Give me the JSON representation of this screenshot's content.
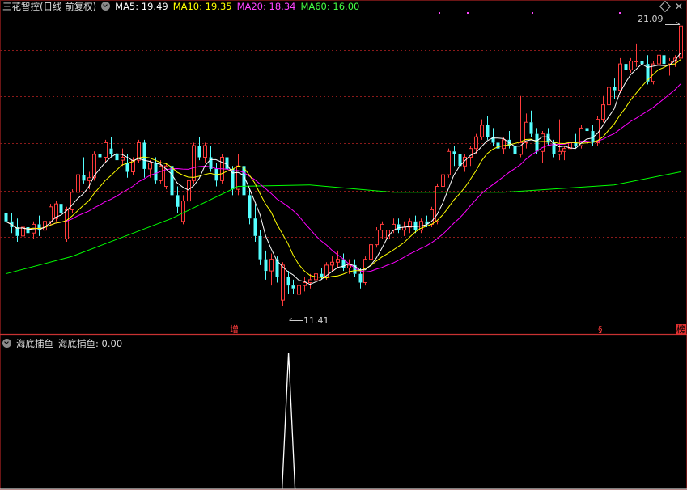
{
  "main_header": {
    "title": "三花智控(日线 前复权)",
    "ma5": "MA5: 19.49",
    "ma10": "MA10: 19.35",
    "ma20": "MA20: 18.34",
    "ma60": "MA60: 16.00"
  },
  "sub_header": {
    "indicator": "海底捕鱼",
    "value": "海底捕鱼: 0.00"
  },
  "annotations": {
    "high": "21.09",
    "low": "11.41",
    "tag_zeng": "增",
    "tag_s": "§",
    "tag_bang": "榜"
  },
  "icons": [
    "chevron-down-icon",
    "diamond-icon",
    "close-icon"
  ],
  "colors": {
    "background": "#000000",
    "up_candle": "#ff3b3b",
    "down_candle": "#54ffff",
    "ma5": "#ffffff",
    "ma10": "#ffff00",
    "ma20": "#ff00ff",
    "ma60": "#00ff00",
    "grid": "#8b1a1a",
    "separator": "#c83232"
  },
  "chart_data": {
    "type": "candlestick",
    "price_scale": {
      "high": 21.09,
      "low": 11.41
    },
    "ma_values_last": {
      "MA5": 19.49,
      "MA10": 19.35,
      "MA20": 18.34,
      "MA60": 16.0
    },
    "candles": [
      [
        14.6,
        14.9,
        14.1,
        14.3
      ],
      [
        14.3,
        14.6,
        13.9,
        14.1
      ],
      [
        14.1,
        14.4,
        13.6,
        13.8
      ],
      [
        13.8,
        14.2,
        13.6,
        14.1
      ],
      [
        14.1,
        14.4,
        13.8,
        13.9
      ],
      [
        13.9,
        14.3,
        13.7,
        14.2
      ],
      [
        14.2,
        14.5,
        13.8,
        14.0
      ],
      [
        14.0,
        14.4,
        13.9,
        14.3
      ],
      [
        14.3,
        14.9,
        14.2,
        14.8
      ],
      [
        14.4,
        15.0,
        14.3,
        14.9
      ],
      [
        14.9,
        15.2,
        14.5,
        14.6
      ],
      [
        13.7,
        14.8,
        13.6,
        14.7
      ],
      [
        14.7,
        15.4,
        14.6,
        15.3
      ],
      [
        15.3,
        16.0,
        15.2,
        15.9
      ],
      [
        15.9,
        16.5,
        15.6,
        15.7
      ],
      [
        15.7,
        16.0,
        15.4,
        15.8
      ],
      [
        15.8,
        16.7,
        15.7,
        16.6
      ],
      [
        16.6,
        17.0,
        16.3,
        16.5
      ],
      [
        16.5,
        17.1,
        16.3,
        17.0
      ],
      [
        16.8,
        17.2,
        16.5,
        16.6
      ],
      [
        16.6,
        16.9,
        16.2,
        16.4
      ],
      [
        16.4,
        16.8,
        16.2,
        16.5
      ],
      [
        16.3,
        16.6,
        15.8,
        16.0
      ],
      [
        16.0,
        16.5,
        15.9,
        16.4
      ],
      [
        16.4,
        17.1,
        16.3,
        17.0
      ],
      [
        17.0,
        17.1,
        15.8,
        16.1
      ],
      [
        16.1,
        16.4,
        15.8,
        16.3
      ],
      [
        16.3,
        16.5,
        15.6,
        15.7
      ],
      [
        15.7,
        16.4,
        15.6,
        16.2
      ],
      [
        15.5,
        16.3,
        15.4,
        16.2
      ],
      [
        16.2,
        16.5,
        15.0,
        15.2
      ],
      [
        15.2,
        15.5,
        14.6,
        14.8
      ],
      [
        14.3,
        15.2,
        14.2,
        15.0
      ],
      [
        15.0,
        15.8,
        14.9,
        15.7
      ],
      [
        15.7,
        17.0,
        15.6,
        16.9
      ],
      [
        16.9,
        17.2,
        16.4,
        16.5
      ],
      [
        16.5,
        17.0,
        16.3,
        16.9
      ],
      [
        16.5,
        16.9,
        16.0,
        16.1
      ],
      [
        16.1,
        16.3,
        15.5,
        15.7
      ],
      [
        15.7,
        16.6,
        15.6,
        16.5
      ],
      [
        16.5,
        16.7,
        16.0,
        16.1
      ],
      [
        16.1,
        16.2,
        15.2,
        15.4
      ],
      [
        15.4,
        16.6,
        15.2,
        16.2
      ],
      [
        16.2,
        16.5,
        15.0,
        15.2
      ],
      [
        15.2,
        15.4,
        14.2,
        14.4
      ],
      [
        14.4,
        14.9,
        13.6,
        13.8
      ],
      [
        13.8,
        14.0,
        12.8,
        13.0
      ],
      [
        13.0,
        13.3,
        12.3,
        12.6
      ],
      [
        12.6,
        13.2,
        12.1,
        13.0
      ],
      [
        13.0,
        13.1,
        12.2,
        12.4
      ],
      [
        11.6,
        12.9,
        11.4,
        12.8
      ],
      [
        12.4,
        12.6,
        11.8,
        12.1
      ],
      [
        12.1,
        12.3,
        11.8,
        12.0
      ],
      [
        11.8,
        12.2,
        11.6,
        12.1
      ],
      [
        12.1,
        12.4,
        11.9,
        12.2
      ],
      [
        12.2,
        12.5,
        12.0,
        12.3
      ],
      [
        12.3,
        12.6,
        12.1,
        12.5
      ],
      [
        12.5,
        12.7,
        12.3,
        12.4
      ],
      [
        12.4,
        12.9,
        12.3,
        12.8
      ],
      [
        12.8,
        13.1,
        12.6,
        12.9
      ],
      [
        12.9,
        13.3,
        12.7,
        13.0
      ],
      [
        13.0,
        13.2,
        12.6,
        12.7
      ],
      [
        12.7,
        13.0,
        12.5,
        12.8
      ],
      [
        12.8,
        13.0,
        12.4,
        12.5
      ],
      [
        12.5,
        12.7,
        12.0,
        12.2
      ],
      [
        12.2,
        13.1,
        12.1,
        13.0
      ],
      [
        13.0,
        13.6,
        12.9,
        13.5
      ],
      [
        13.5,
        14.1,
        13.4,
        14.0
      ],
      [
        14.0,
        14.3,
        13.7,
        14.2
      ],
      [
        13.7,
        14.3,
        13.6,
        14.0
      ],
      [
        14.0,
        14.4,
        13.9,
        14.2
      ],
      [
        14.2,
        14.4,
        13.9,
        14.0
      ],
      [
        14.0,
        14.3,
        13.8,
        14.1
      ],
      [
        14.1,
        14.4,
        13.9,
        14.3
      ],
      [
        14.3,
        14.5,
        13.9,
        14.0
      ],
      [
        14.0,
        14.4,
        13.9,
        14.3
      ],
      [
        14.3,
        14.5,
        14.1,
        14.2
      ],
      [
        14.2,
        14.8,
        14.1,
        14.7
      ],
      [
        14.3,
        15.6,
        14.2,
        15.5
      ],
      [
        15.5,
        16.0,
        15.3,
        15.9
      ],
      [
        15.9,
        16.8,
        15.8,
        16.7
      ],
      [
        16.7,
        16.9,
        16.2,
        16.6
      ],
      [
        16.6,
        16.8,
        16.1,
        16.2
      ],
      [
        16.2,
        16.6,
        16.0,
        16.5
      ],
      [
        16.5,
        16.9,
        16.2,
        16.8
      ],
      [
        16.8,
        17.3,
        16.6,
        17.2
      ],
      [
        17.2,
        17.8,
        17.1,
        17.6
      ],
      [
        17.6,
        17.9,
        17.1,
        17.2
      ],
      [
        17.2,
        17.5,
        16.9,
        17.0
      ],
      [
        17.0,
        17.3,
        16.7,
        16.8
      ],
      [
        16.8,
        17.2,
        16.6,
        17.1
      ],
      [
        17.1,
        17.4,
        16.8,
        16.9
      ],
      [
        16.9,
        17.1,
        16.5,
        16.6
      ],
      [
        16.6,
        18.6,
        16.5,
        17.0
      ],
      [
        17.0,
        18.0,
        16.8,
        17.7
      ],
      [
        17.7,
        18.1,
        17.2,
        17.3
      ],
      [
        17.3,
        17.5,
        16.6,
        16.7
      ],
      [
        16.7,
        17.4,
        16.3,
        17.3
      ],
      [
        17.3,
        17.5,
        16.9,
        17.0
      ],
      [
        17.0,
        17.1,
        16.5,
        16.6
      ],
      [
        16.6,
        17.8,
        16.4,
        16.7
      ],
      [
        16.7,
        16.9,
        16.4,
        16.8
      ],
      [
        16.8,
        17.1,
        16.7,
        17.0
      ],
      [
        17.0,
        17.3,
        16.8,
        16.9
      ],
      [
        16.9,
        17.6,
        16.8,
        17.5
      ],
      [
        17.5,
        18.0,
        17.3,
        17.4
      ],
      [
        17.4,
        17.6,
        16.9,
        17.0
      ],
      [
        17.0,
        17.9,
        16.9,
        17.8
      ],
      [
        17.8,
        18.6,
        17.7,
        18.3
      ],
      [
        18.3,
        19.0,
        18.2,
        18.9
      ],
      [
        18.9,
        19.2,
        18.5,
        18.8
      ],
      [
        18.8,
        19.9,
        18.7,
        19.7
      ],
      [
        19.7,
        20.2,
        19.3,
        19.5
      ],
      [
        19.5,
        19.9,
        19.4,
        19.8
      ],
      [
        19.8,
        20.4,
        19.6,
        19.8
      ],
      [
        19.8,
        20.2,
        19.6,
        19.7
      ],
      [
        19.7,
        20.0,
        19.0,
        19.1
      ],
      [
        19.1,
        19.8,
        19.0,
        19.7
      ],
      [
        19.7,
        20.1,
        19.5,
        20.0
      ],
      [
        20.0,
        20.2,
        19.6,
        19.7
      ],
      [
        19.7,
        19.9,
        19.3,
        19.8
      ],
      [
        19.8,
        20.0,
        19.6,
        19.9
      ],
      [
        19.9,
        21.1,
        19.8,
        21.0
      ]
    ],
    "sub_indicator": {
      "name": "海底捕鱼",
      "value": 0.0,
      "signal_at_candle_index": 51
    }
  }
}
